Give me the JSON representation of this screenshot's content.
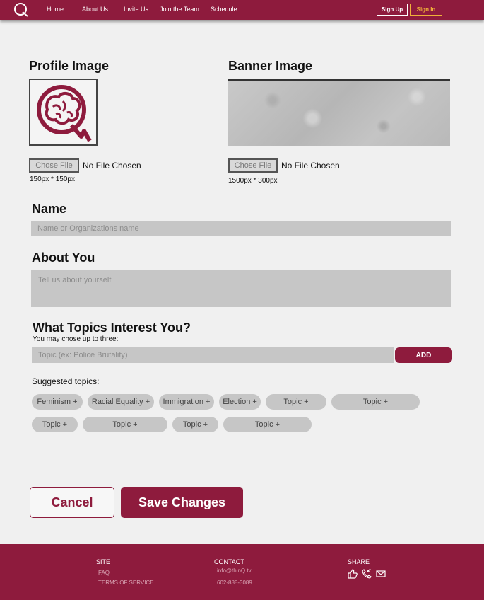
{
  "header": {
    "nav": [
      "Home",
      "About Us",
      "Invite Us",
      "Join the Team",
      "Schedule"
    ],
    "sign_up": "Sign Up",
    "sign_in": "Sign In"
  },
  "profile_image": {
    "title": "Profile Image",
    "choose_file": "Chose File",
    "status": "No File Chosen",
    "hint": "150px * 150px"
  },
  "banner_image": {
    "title": "Banner Image",
    "choose_file": "Chose File",
    "status": "No File Chosen",
    "hint": "1500px * 300px"
  },
  "name": {
    "title": "Name",
    "placeholder": "Name or Organizations name"
  },
  "about": {
    "title": "About You",
    "placeholder": "Tell us about yourself"
  },
  "topics": {
    "title": "What Topics Interest You?",
    "note": "You may chose up to three:",
    "placeholder": "Topic (ex: Police Brutality)",
    "add": "ADD",
    "suggested_label": "Suggested topics:",
    "chips": [
      "Feminism +",
      "Racial Equality +",
      "Immigration +",
      "Election +",
      "Topic +",
      "Topic +",
      "Topic +",
      "Topic +",
      "Topic +",
      "Topic +"
    ]
  },
  "actions": {
    "cancel": "Cancel",
    "save": "Save Changes"
  },
  "footer": {
    "site_heading": "SITE",
    "site_links": [
      "FAQ",
      "TERMS OF SERVICE"
    ],
    "contact_heading": "CONTACT",
    "email": "info@thinQ.tv",
    "phone": "602-888-3089",
    "share_heading": "SHARE",
    "share_icons": [
      "thumbs-up-icon",
      "phone-icon",
      "mail-icon"
    ]
  },
  "colors": {
    "brand": "#8e1b3d",
    "accent": "#f0b13a",
    "input_bg": "#c6c6c6"
  }
}
